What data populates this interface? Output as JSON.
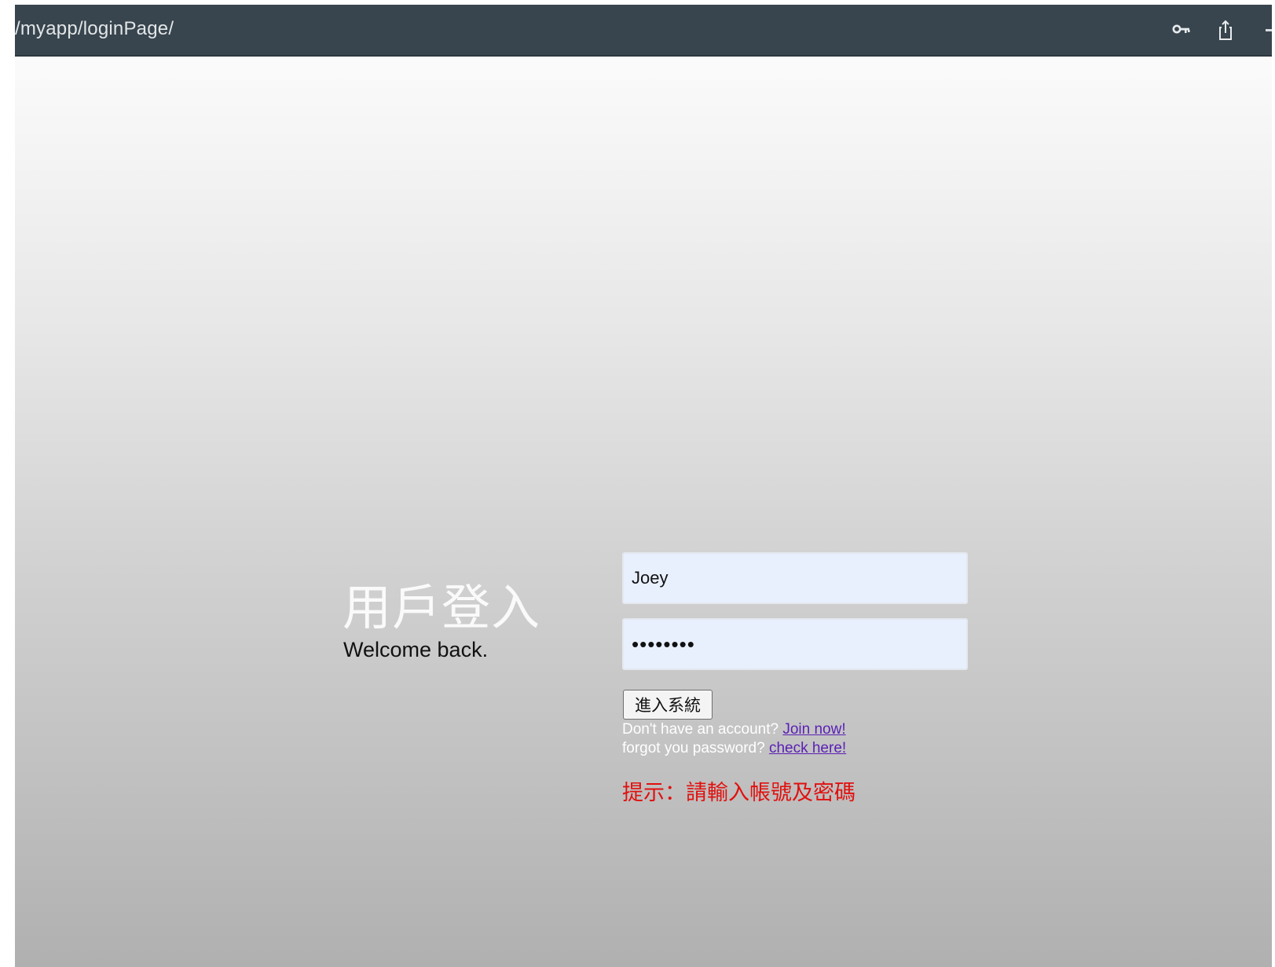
{
  "browser": {
    "url": "/myapp/loginPage/",
    "icons": [
      "key-icon",
      "share-icon",
      "more-icon"
    ]
  },
  "login": {
    "title": "用戶登入",
    "subtitle": "Welcome back.",
    "username_value": "Joey",
    "password_value": "••••••••",
    "submit_label": "進入系統",
    "signup_prompt": "Don't have an account?",
    "signup_link": "Join now!",
    "forgot_prompt": "forgot you password?",
    "forgot_link": "check here!",
    "hint": "提示：請輸入帳號及密碼"
  },
  "colors": {
    "urlbar": "#38454e",
    "link": "#5a1fb5",
    "hint": "#e0110f",
    "input_bg": "#e8f0fe"
  }
}
